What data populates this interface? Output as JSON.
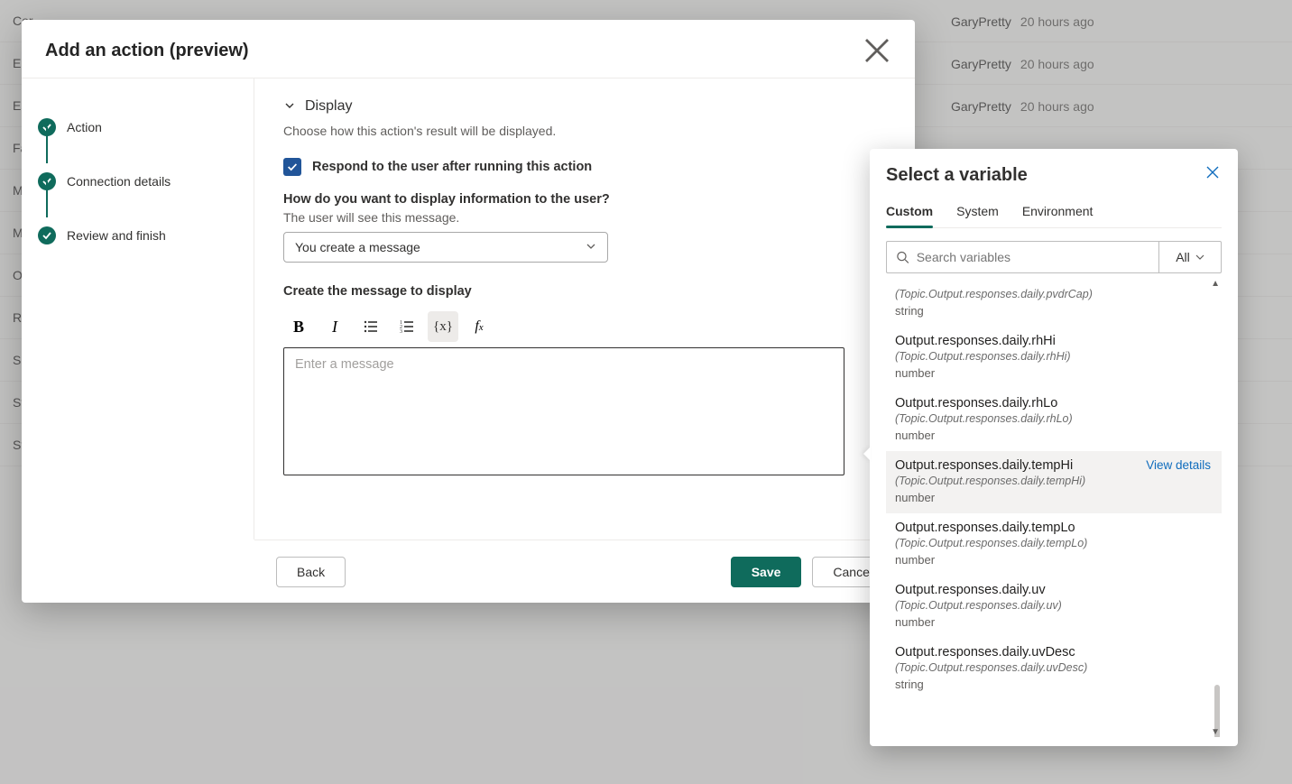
{
  "background": {
    "rows": [
      "Cor",
      "End",
      "Esc",
      "Fall",
      "MS",
      "Mu",
      "On",
      "Res",
      "Sig",
      "Sto",
      "Sto"
    ],
    "author": "GaryPretty",
    "time": "20 hours ago"
  },
  "modal": {
    "title": "Add an action (preview)",
    "steps": [
      "Action",
      "Connection details",
      "Review and finish"
    ],
    "display_section": {
      "header": "Display",
      "description": "Choose how this action's result will be displayed.",
      "checkbox_label": "Respond to the user after running this action",
      "question": "How do you want to display information to the user?",
      "sub": "The user will see this message.",
      "select_value": "You create a message",
      "create_label": "Create the message to display",
      "editor_placeholder": "Enter a message"
    },
    "buttons": {
      "back": "Back",
      "save": "Save",
      "cancel": "Cancel"
    }
  },
  "picker": {
    "title": "Select a variable",
    "tabs": [
      "Custom",
      "System",
      "Environment"
    ],
    "active_tab": 0,
    "search_placeholder": "Search variables",
    "filter_label": "All",
    "view_details": "View details",
    "vars": [
      {
        "name": "",
        "path": "(Topic.Output.responses.daily.pvdrCap)",
        "type": "string",
        "truncated_top": true
      },
      {
        "name": "Output.responses.daily.rhHi",
        "path": "(Topic.Output.responses.daily.rhHi)",
        "type": "number"
      },
      {
        "name": "Output.responses.daily.rhLo",
        "path": "(Topic.Output.responses.daily.rhLo)",
        "type": "number"
      },
      {
        "name": "Output.responses.daily.tempHi",
        "path": "(Topic.Output.responses.daily.tempHi)",
        "type": "number",
        "hover": true
      },
      {
        "name": "Output.responses.daily.tempLo",
        "path": "(Topic.Output.responses.daily.tempLo)",
        "type": "number"
      },
      {
        "name": "Output.responses.daily.uv",
        "path": "(Topic.Output.responses.daily.uv)",
        "type": "number"
      },
      {
        "name": "Output.responses.daily.uvDesc",
        "path": "(Topic.Output.responses.daily.uvDesc)",
        "type": "string"
      }
    ]
  }
}
